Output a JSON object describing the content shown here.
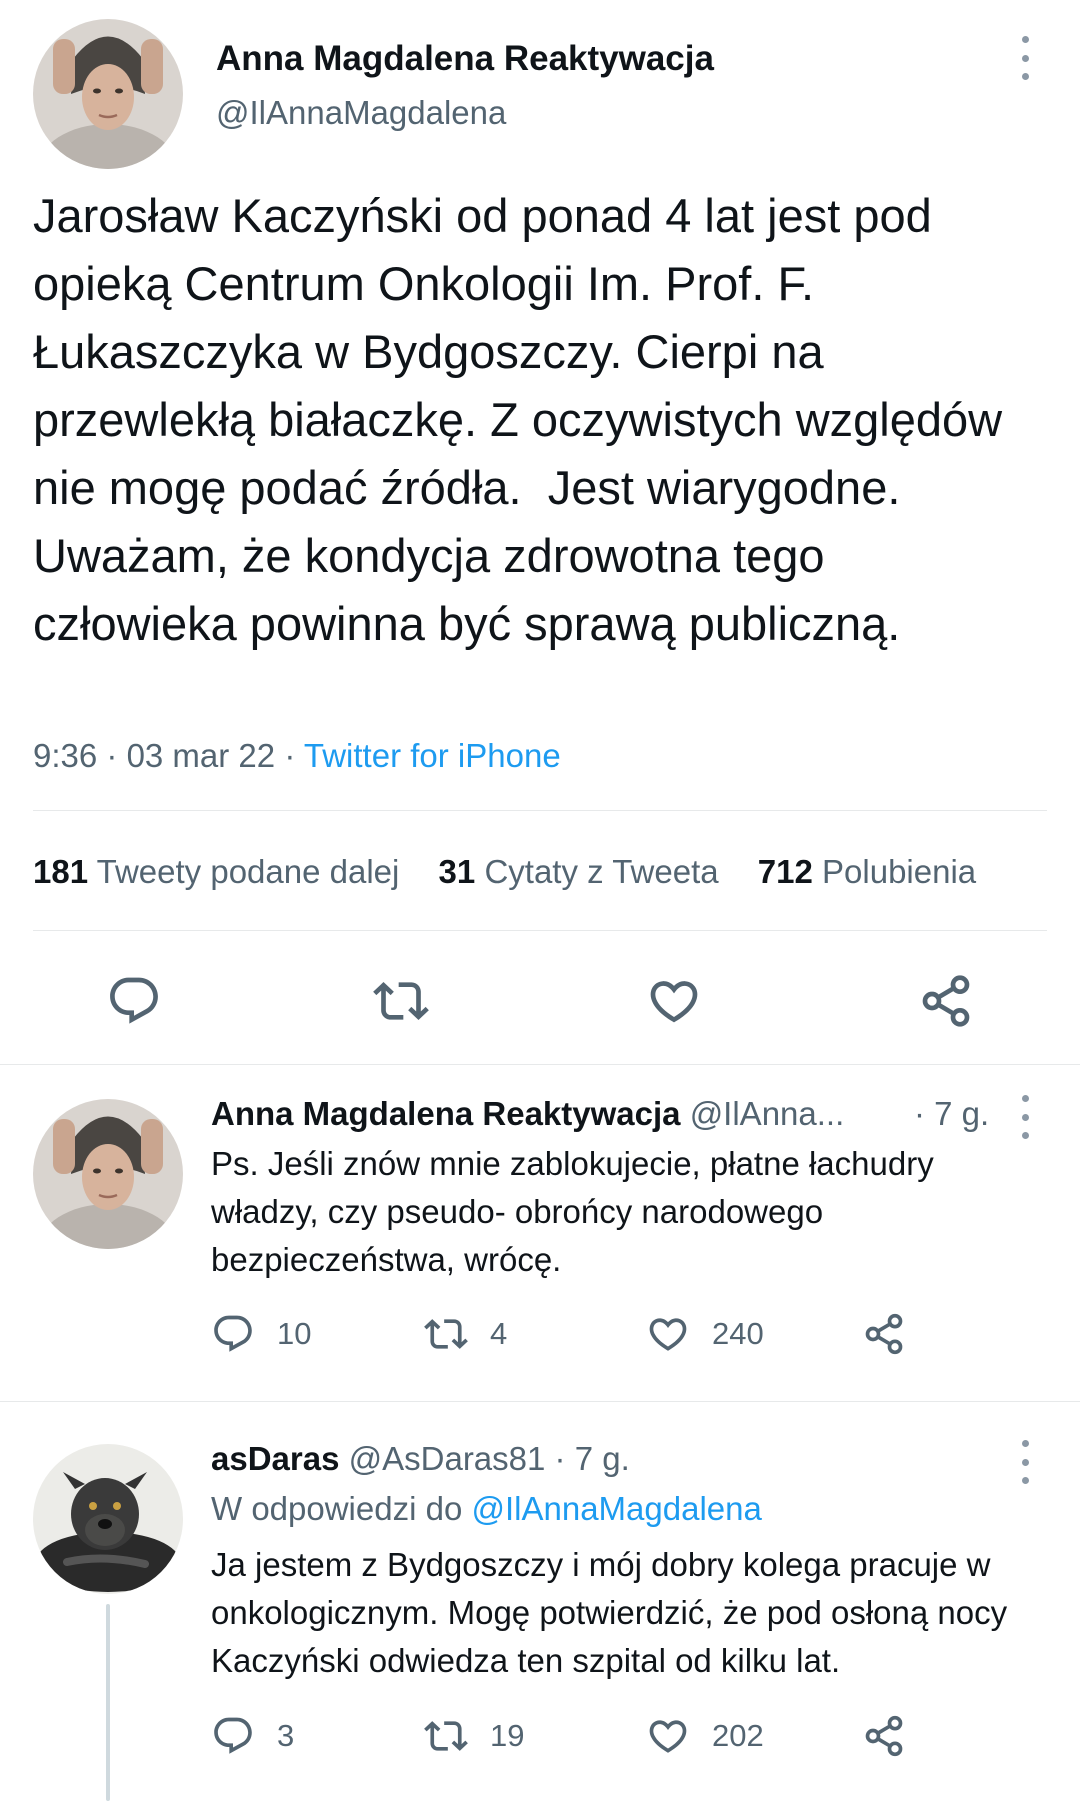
{
  "main_tweet": {
    "display_name": "Anna Magdalena Reaktywacja",
    "handle": "@IlAnnaMagdalena",
    "text": "Jarosław Kaczyński od ponad 4 lat jest pod opieką Centrum Onkologii Im. Prof. F. Łukaszczyka w Bydgoszczy. Cierpi na przewlekłą białaczkę. Z oczywistych względów nie mogę podać źródła.  Jest wiarygodne. Uważam, że kondycja zdrowotna tego człowieka powinna być sprawą publiczną.",
    "time": "9:36",
    "date": "03 mar 22",
    "source": "Twitter for iPhone",
    "stats": {
      "retweets": {
        "count": "181",
        "label": "Tweety podane dalej"
      },
      "quotes": {
        "count": "31",
        "label": "Cytaty z Tweeta"
      },
      "likes": {
        "count": "712",
        "label": "Polubienia"
      }
    }
  },
  "replies": [
    {
      "display_name": "Anna Magdalena Reaktywacja",
      "handle": "@IlAnna...",
      "age": "· 7 g.",
      "text": "Ps. Jeśli znów mnie zablokujecie, płatne łachudry władzy, czy pseudo- obrońcy narodowego bezpieczeństwa, wrócę.",
      "reply_count": "10",
      "retweet_count": "4",
      "like_count": "240"
    },
    {
      "display_name": "asDaras",
      "handle": "@AsDaras81",
      "age": "· 7 g.",
      "reply_to_prefix": "W odpowiedzi do",
      "reply_to_handle": "@IlAnnaMagdalena",
      "text": "Ja jestem z Bydgoszczy i mój dobry kolega pracuje w onkologicznym. Mogę potwierdzić, że pod osłoną nocy Kaczyński odwiedza ten szpital od kilku lat.",
      "reply_count": "3",
      "retweet_count": "19",
      "like_count": "202"
    }
  ],
  "icons": {
    "reply": "speech-bubble-icon",
    "retweet": "retweet-arrows-icon",
    "like": "heart-icon",
    "share": "share-nodes-icon",
    "more": "vertical-dots-icon"
  },
  "colors": {
    "text": "#0f1419",
    "muted": "#536471",
    "link": "#1d9bf0",
    "divider": "#e7e9ea"
  }
}
